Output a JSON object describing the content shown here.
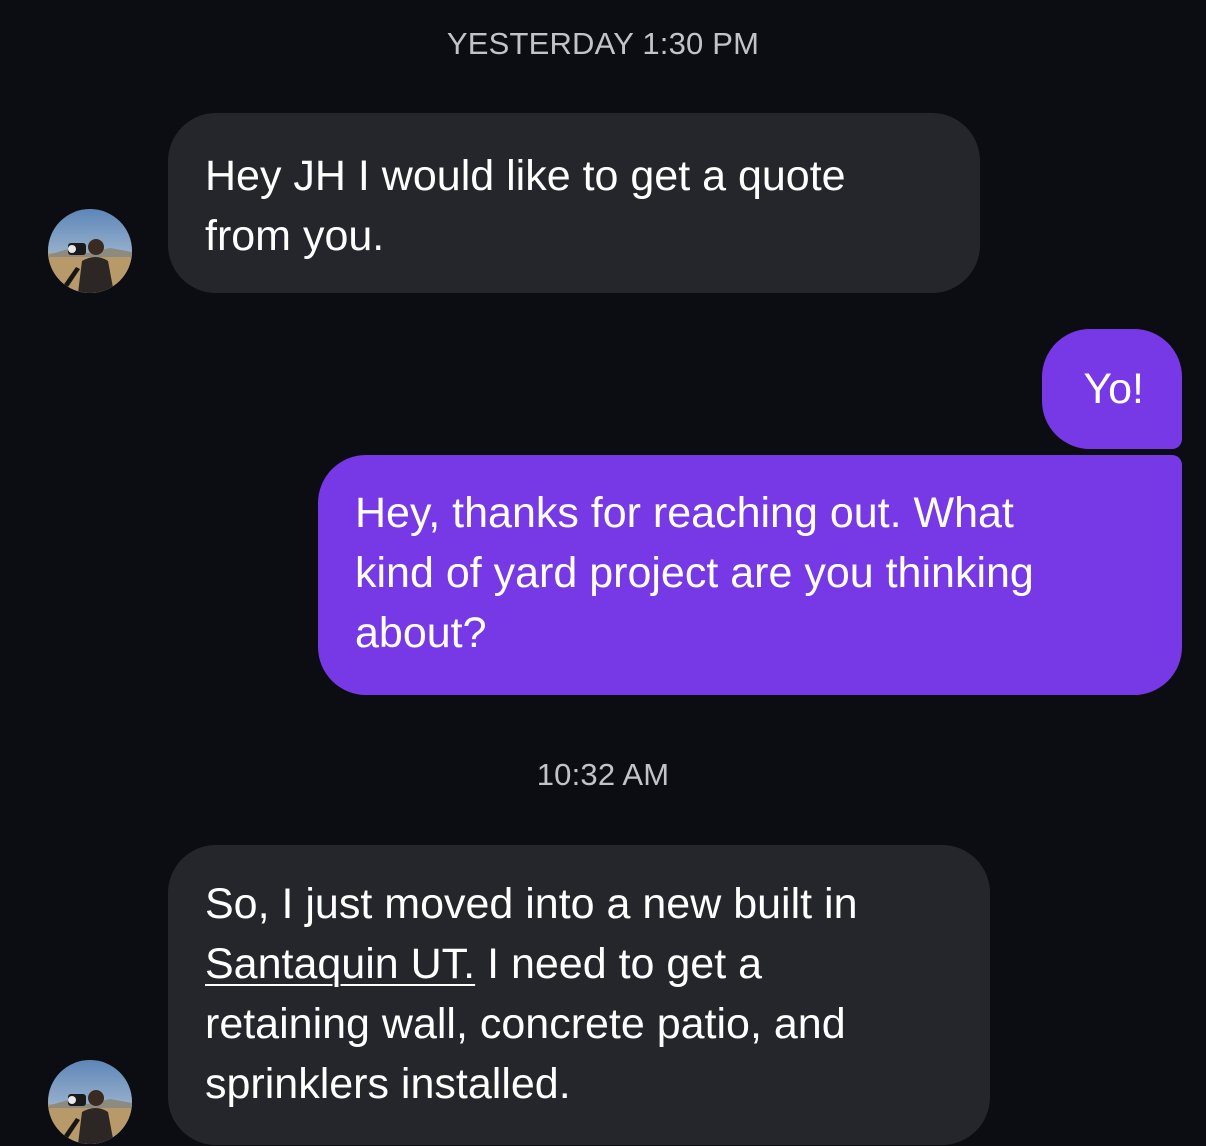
{
  "thread": {
    "timestamps": {
      "first": "YESTERDAY 1:30 PM",
      "second": "10:32 AM"
    },
    "messages": [
      {
        "direction": "incoming",
        "lines": [
          "Hey JH I would like to get a quote",
          "from you."
        ]
      },
      {
        "direction": "outgoing",
        "lines": [
          "Yo!"
        ]
      },
      {
        "direction": "outgoing",
        "lines": [
          "Hey, thanks for reaching out. What",
          "kind of yard project are you thinking",
          "about?"
        ]
      },
      {
        "direction": "incoming",
        "line1": "So, I just moved into a new built in",
        "link_text": "Santaquin UT.",
        "line2_rest": " I need to get a",
        "line3": "retaining wall, concrete patio, and",
        "line4": "sprinklers installed."
      }
    ]
  },
  "avatar": {
    "icon": "contact-photo"
  },
  "colors": {
    "background": "#0c0d12",
    "incoming_bubble": "#25262b",
    "outgoing_bubble": "#7739e6",
    "timestamp_text": "#c2c3c8"
  }
}
